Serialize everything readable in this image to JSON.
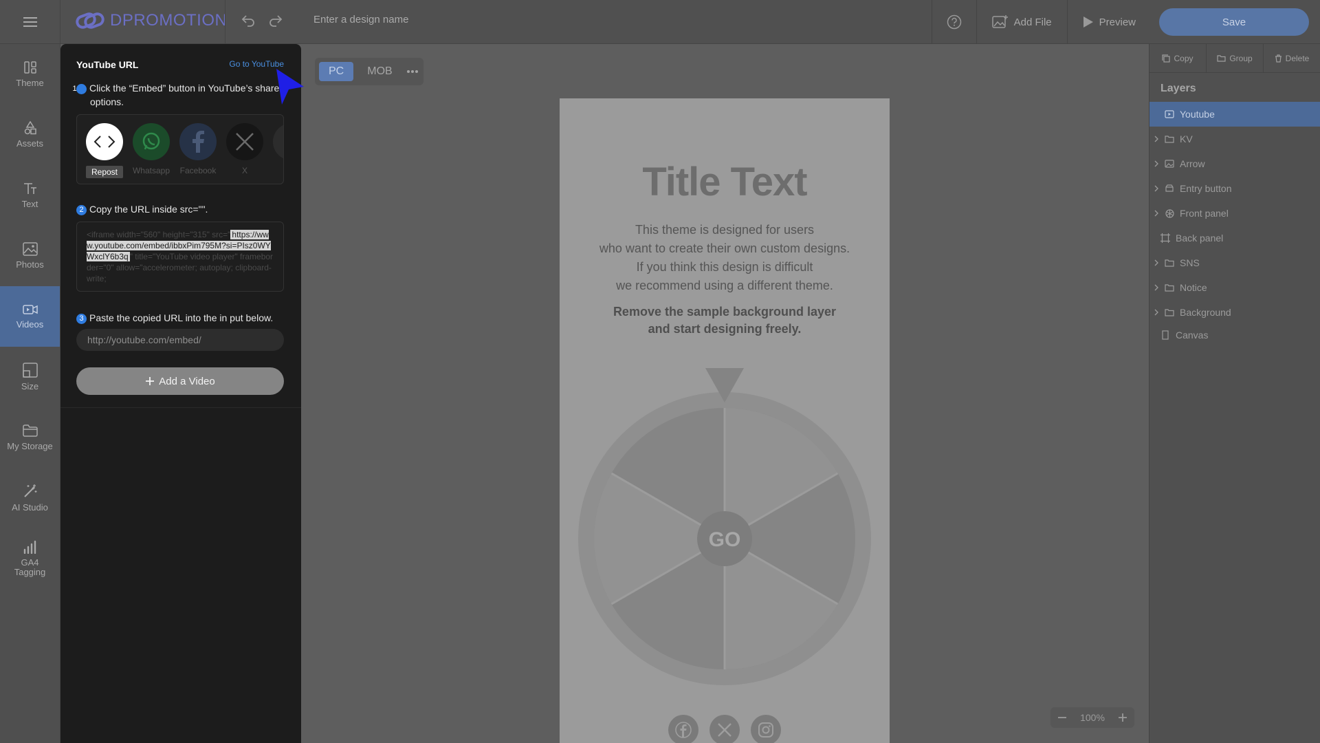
{
  "app": {
    "logo_text": "DPROMOTION",
    "brand_color": "#6b6fc4",
    "accent_color": "#4c6a98"
  },
  "topbar": {
    "design_name_placeholder": "Enter a design name",
    "add_file_label": "Add File",
    "preview_label": "Preview",
    "save_label": "Save"
  },
  "sidebar": {
    "items": [
      {
        "label": "Theme",
        "icon": "theme-icon"
      },
      {
        "label": "Assets",
        "icon": "assets-icon"
      },
      {
        "label": "Text",
        "icon": "text-icon"
      },
      {
        "label": "Photos",
        "icon": "photos-icon"
      },
      {
        "label": "Videos",
        "icon": "videos-icon",
        "active": true
      },
      {
        "label": "Size",
        "icon": "size-icon"
      },
      {
        "label": "My Storage",
        "icon": "folder-icon"
      },
      {
        "label": "AI Studio",
        "icon": "magic-wand-icon"
      },
      {
        "label": "GA4 Tagging",
        "icon": "bar-chart-icon"
      }
    ]
  },
  "youtube_panel": {
    "title": "YouTube URL",
    "goto_link": "Go to YouTube",
    "step1": {
      "num": "1",
      "text": "Click the “Embed” button in YouTube’s share options."
    },
    "share_options": [
      {
        "label": "Repost",
        "icon": "embed-code-icon",
        "active": true
      },
      {
        "label": "Whatsapp",
        "icon": "whatsapp-icon"
      },
      {
        "label": "Facebook",
        "icon": "facebook-icon"
      },
      {
        "label": "X",
        "icon": "x-icon"
      }
    ],
    "step2": {
      "num": "2",
      "text": "Copy the URL inside src=\"\"."
    },
    "code": {
      "before": "<iframe width=\"560\" height=\"315\" src=\"",
      "highlight": "https://www.youtube.com/embed/ibbxPim795M?si=PIsz0WYWxclY6b3q",
      "after": "\" title=\"YouTube video player\" frameborder=\"0\" allow=\"accelerometer; autoplay; clipboard-write;"
    },
    "step3": {
      "num": "3",
      "text": "Paste the copied URL into the in put below."
    },
    "url_placeholder": "http://youtube.com/embed/",
    "add_video_label": "Add a Video"
  },
  "device_toggle": {
    "pc_label": "PC",
    "mob_label": "MOB",
    "active": "PC"
  },
  "canvas": {
    "title": "Title Text",
    "description": [
      "This theme is designed for users",
      "who want to create their own custom designs.",
      "If you think this design is difficult",
      "we recommend using a different theme."
    ],
    "bold_lines": [
      "Remove the sample background layer",
      "and start designing freely."
    ],
    "wheel_button": "GO"
  },
  "zoom": {
    "level": "100%"
  },
  "right_panel": {
    "actions": [
      {
        "label": "Copy",
        "icon": "copy-icon"
      },
      {
        "label": "Group",
        "icon": "folder-icon"
      },
      {
        "label": "Delete",
        "icon": "trash-icon"
      }
    ],
    "layers_title": "Layers",
    "layers": [
      {
        "label": "Youtube",
        "icon": "video-icon",
        "active": true,
        "expandable": false
      },
      {
        "label": "KV",
        "icon": "folder-icon",
        "expandable": true
      },
      {
        "label": "Arrow",
        "icon": "image-icon",
        "expandable": true
      },
      {
        "label": "Entry button",
        "icon": "button-icon",
        "expandable": true
      },
      {
        "label": "Front panel",
        "icon": "wheel-icon",
        "expandable": true
      },
      {
        "label": "Back panel",
        "icon": "frame-icon",
        "expandable": false
      },
      {
        "label": "SNS",
        "icon": "folder-icon",
        "expandable": true
      },
      {
        "label": "Notice",
        "icon": "folder-icon",
        "expandable": true
      },
      {
        "label": "Background",
        "icon": "folder-icon",
        "expandable": true
      },
      {
        "label": "Canvas",
        "icon": "page-icon",
        "expandable": false
      }
    ]
  }
}
